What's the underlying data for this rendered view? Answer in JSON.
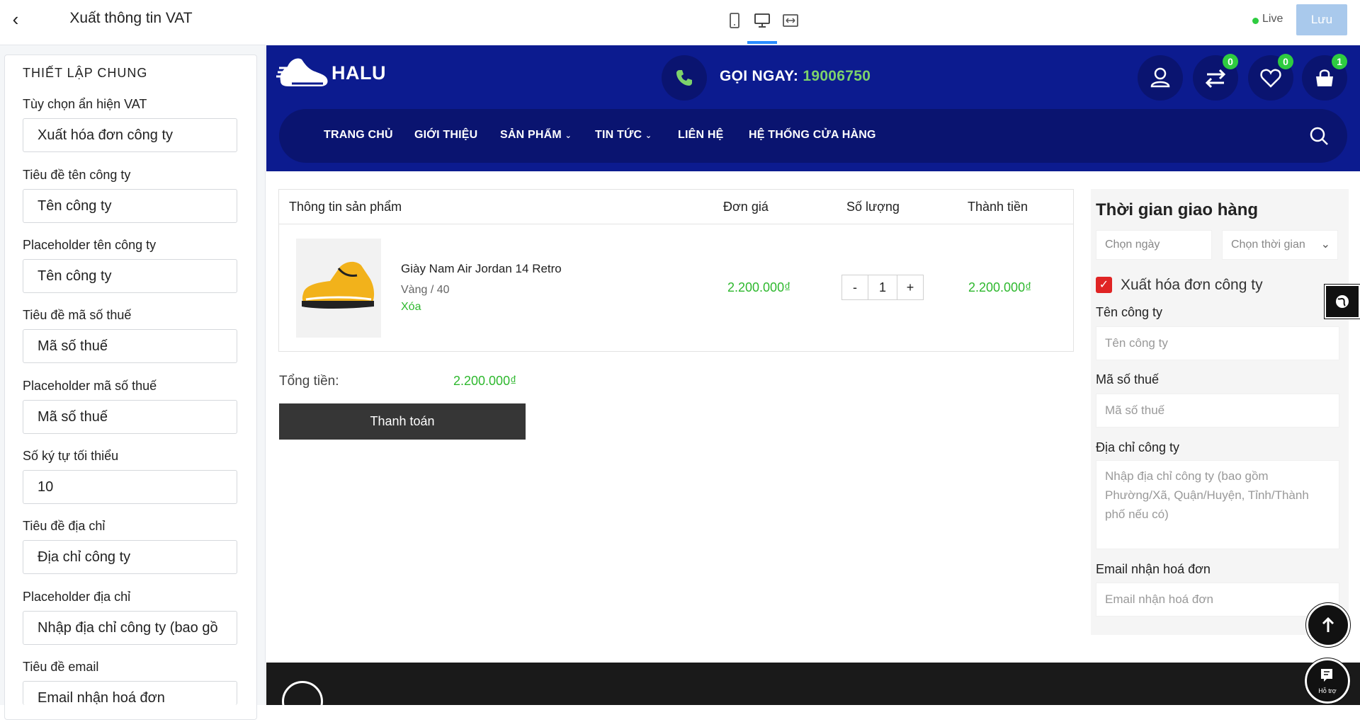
{
  "left_panel": {
    "title": "Xuất thông tin VAT",
    "section": "THIẾT LẬP CHUNG",
    "fields": [
      {
        "label": "Tùy chọn ẩn hiện VAT",
        "value": "Xuất hóa đơn công ty"
      },
      {
        "label": "Tiêu đề tên công ty",
        "value": "Tên công ty"
      },
      {
        "label": "Placeholder tên công ty",
        "value": "Tên công ty"
      },
      {
        "label": "Tiêu đề mã số thuế",
        "value": "Mã số thuế"
      },
      {
        "label": "Placeholder mã số thuế",
        "value": "Mã số thuế"
      },
      {
        "label": "Số ký tự tối thiểu",
        "value": "10"
      },
      {
        "label": "Tiêu đề địa chỉ",
        "value": "Địa chỉ công ty"
      },
      {
        "label": "Placeholder địa chỉ",
        "value": "Nhập địa chỉ công ty (bao gồ"
      },
      {
        "label": "Tiêu đề email",
        "value": "Email nhận hoá đơn"
      }
    ]
  },
  "topbar": {
    "live": "Live",
    "save": "Lưu"
  },
  "site": {
    "logo": "HALU",
    "call_label": "GỌI NGAY:",
    "phone": "19006750",
    "badges": {
      "compare": "0",
      "wishlist": "0",
      "cart": "1"
    },
    "nav": [
      "TRANG CHỦ",
      "GIỚI THIỆU",
      "SẢN PHẨM",
      "TIN TỨC",
      "LIÊN HỆ",
      "HỆ THỐNG CỬA HÀNG"
    ]
  },
  "cart": {
    "headers": [
      "Thông tin sản phẩm",
      "Đơn giá",
      "Số lượng",
      "Thành tiền"
    ],
    "item": {
      "name": "Giày Nam Air Jordan 14 Retro",
      "variant": "Vàng / 40",
      "remove": "Xóa",
      "price": "2.200.000₫",
      "qty": "1",
      "minus": "-",
      "plus": "+",
      "total": "2.200.000₫"
    },
    "total_label": "Tổng tiền:",
    "total_value": "2.200.000₫",
    "checkout": "Thanh toán"
  },
  "delivery": {
    "title": "Thời gian giao hàng",
    "date_placeholder": "Chọn ngày",
    "time_placeholder": "Chọn thời gian",
    "vat_checkbox": "Xuất hóa đơn công ty",
    "company_label": "Tên công ty",
    "company_placeholder": "Tên công ty",
    "tax_label": "Mã số thuế",
    "tax_placeholder": "Mã số thuế",
    "address_label": "Địa chỉ công ty",
    "address_placeholder": "Nhập địa chỉ công ty (bao gồm Phường/Xã, Quận/Huyện, Tỉnh/Thành phố nếu có)",
    "email_label": "Email nhận hoá đơn",
    "email_placeholder": "Email nhận hoá đơn"
  },
  "help_label": "Hỗ trợ",
  "colors": {
    "brand": "#0c1b8f",
    "accent": "#2eb82e",
    "save": "#a9c9ec"
  }
}
